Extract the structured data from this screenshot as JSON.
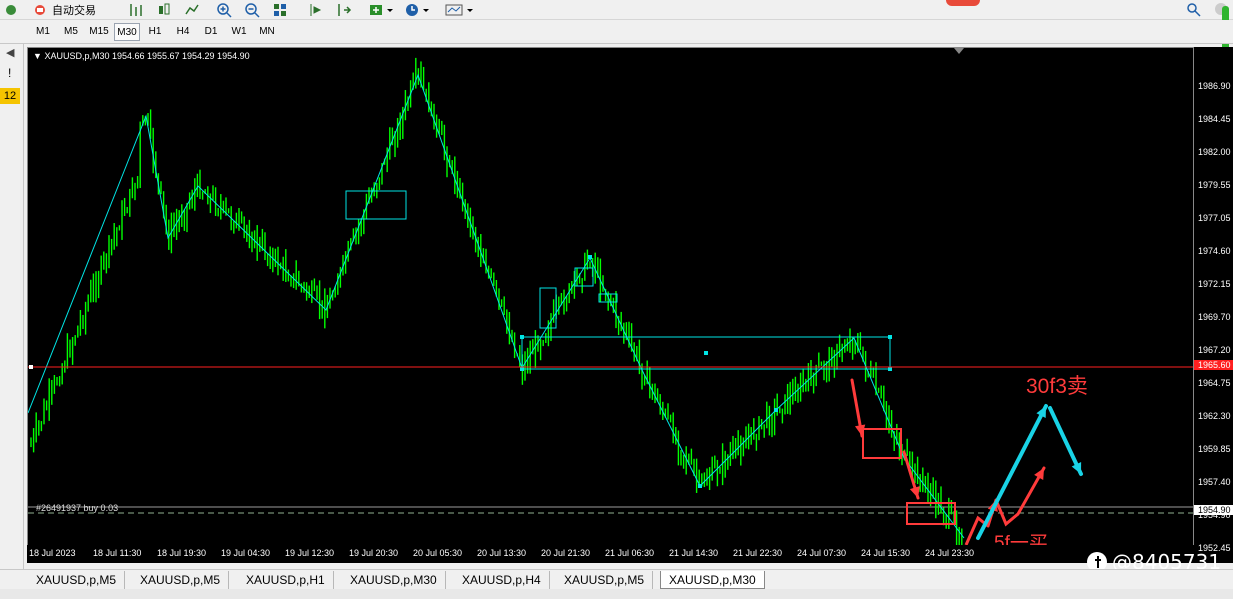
{
  "toolbar": {
    "auto_trading_label": "自动交易"
  },
  "timeframes": [
    "M1",
    "M5",
    "M15",
    "M30",
    "H1",
    "H4",
    "D1",
    "W1",
    "MN"
  ],
  "active_timeframe": "M30",
  "left_panel": {
    "marker": "!",
    "badge": "12"
  },
  "chart": {
    "header": "XAUUSD,p,M30  1954.66 1955.67 1954.29 1954.90",
    "order_label": "#26491937 buy 0.03",
    "current_price": "1954.90",
    "red_line_price": "1965.60",
    "annotation_sell": "30f3卖",
    "annotation_buy": "5f一买",
    "watermark": "@8405731",
    "colors": {
      "background": "#000000",
      "candles": "#00ff00",
      "zigzag": "#00e5e5",
      "red_line": "#ff2020",
      "annotation": "#ff3b3b",
      "arrow_cyan": "#19d3e6"
    }
  },
  "price_ticks": [
    "1986.90",
    "1984.45",
    "1982.00",
    "1979.55",
    "1977.05",
    "1974.60",
    "1972.15",
    "1969.70",
    "1967.20",
    "1964.75",
    "1962.30",
    "1959.85",
    "1957.40",
    "1954.90",
    "1952.45"
  ],
  "time_ticks": [
    "18 Jul 2023",
    "18 Jul 11:30",
    "18 Jul 19:30",
    "19 Jul 04:30",
    "19 Jul 12:30",
    "19 Jul 20:30",
    "20 Jul 05:30",
    "20 Jul 13:30",
    "20 Jul 21:30",
    "21 Jul 06:30",
    "21 Jul 14:30",
    "21 Jul 22:30",
    "24 Jul 07:30",
    "24 Jul 15:30",
    "24 Jul 23:30"
  ],
  "tabs": [
    "XAUUSD,p,M5",
    "XAUUSD,p,M5",
    "XAUUSD,p,H1",
    "XAUUSD,p,M30",
    "XAUUSD,p,H4",
    "XAUUSD,p,M5",
    "XAUUSD,p,M30"
  ],
  "active_tab_index": 6
}
